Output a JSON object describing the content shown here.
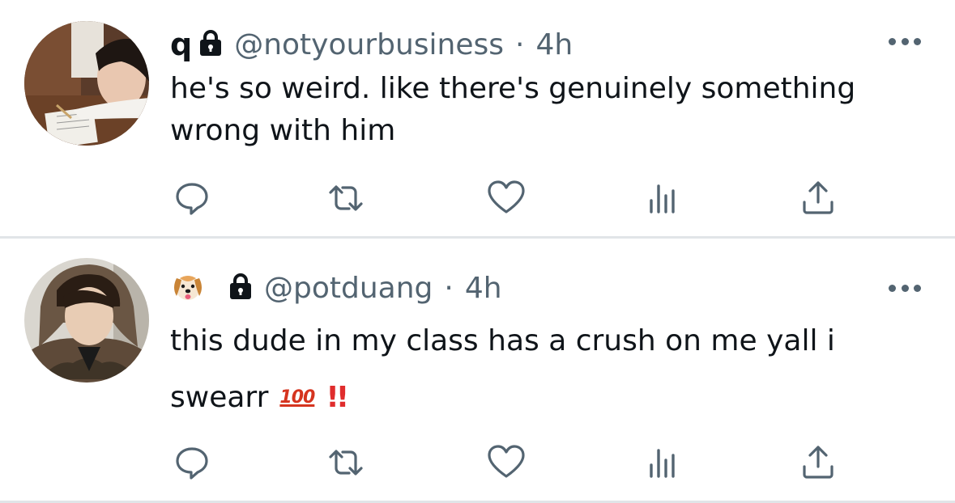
{
  "tweets": [
    {
      "display_name": "q",
      "handle": "@notyourbusiness",
      "separator": "·",
      "time": "4h",
      "text": "he's so weird. like there's genuinely something wrong with him",
      "text_lines": [
        "he's so weird. like there's genuinely something",
        "wrong with him"
      ],
      "protected": true,
      "avatar": "avatar-photo-desk"
    },
    {
      "display_name_emoji": "dog-face-emoji",
      "handle": "@potduang",
      "separator": "·",
      "time": "4h",
      "text_lines": [
        "this dude in my class has a crush on me yall i",
        "swearr"
      ],
      "emoji_100": "100",
      "emoji_bangs": "!!",
      "protected": true,
      "avatar": "avatar-photo-hoodie"
    }
  ],
  "actions": [
    "reply-icon",
    "retweet-icon",
    "like-icon",
    "views-icon",
    "share-icon"
  ],
  "colors": {
    "text": "#0f1419",
    "secondary": "#536471",
    "divider": "#e1e5e8",
    "hundred": "#d5341f",
    "bangs": "#e02d2d"
  }
}
